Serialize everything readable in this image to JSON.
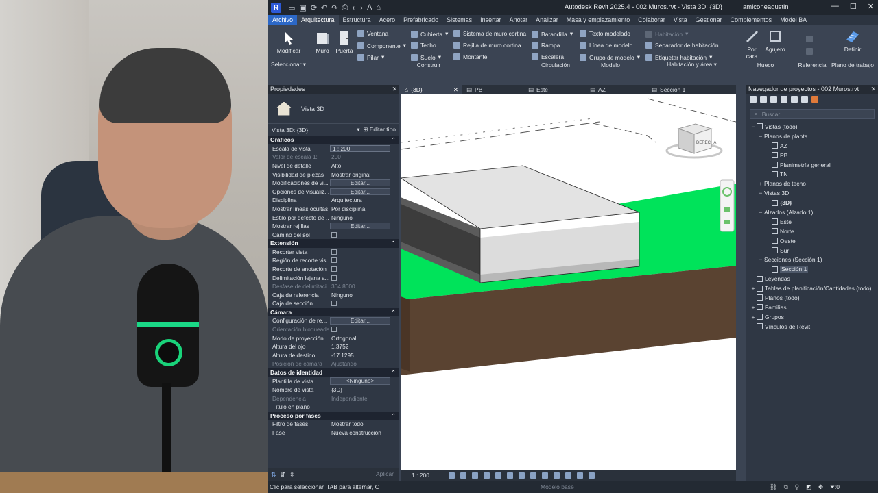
{
  "titlebar": {
    "app_icon": "R",
    "title": "Autodesk Revit 2025.4 - 002 Muros.rvt - Vista 3D: {3D}",
    "user": "amiconeagustin",
    "minimize": "—",
    "maximize": "☐",
    "close": "✕"
  },
  "menu": {
    "file": "Archivo",
    "tabs": [
      "Arquitectura",
      "Estructura",
      "Acero",
      "Prefabricado",
      "Sistemas",
      "Insertar",
      "Anotar",
      "Analizar",
      "Masa y emplazamiento",
      "Colaborar",
      "Vista",
      "Gestionar",
      "Complementos",
      "Model BA"
    ],
    "active": "Arquitectura"
  },
  "ribbon": {
    "modify": "Modificar",
    "select_label": "Seleccionar",
    "build": {
      "muro": "Muro",
      "puerta": "Puerta",
      "ventana": "Ventana",
      "componente": "Componente",
      "pilar": "Pilar",
      "cubierta": "Cubierta",
      "techo": "Techo",
      "suelo": "Suelo",
      "sistema_muro_cortina": "Sistema de muro cortina",
      "rejilla_muro_cortina": "Rejilla de muro cortina",
      "montante": "Montante",
      "label": "Construir"
    },
    "circulation": {
      "barandilla": "Barandilla",
      "rampa": "Rampa",
      "escalera": "Escalera",
      "label": "Circulación"
    },
    "model": {
      "texto_modelado": "Texto modelado",
      "linea_modelo": "Línea de modelo",
      "grupo_modelo": "Grupo de modelo",
      "label": "Modelo"
    },
    "room": {
      "habitacion": "Habitación",
      "separador": "Separador de habitación",
      "etiquetar": "Etiquetar habitación",
      "label": "Habitación y área"
    },
    "opening": {
      "por_cara": "Por cara",
      "agujero": "Agujero",
      "label": "Hueco"
    },
    "reference": {
      "label": "Referencia"
    },
    "workplane": {
      "definir": "Definir",
      "label": "Plano de trabajo"
    }
  },
  "properties": {
    "header": "Propiedades",
    "type_name": "Vista 3D",
    "type_selector": "Vista 3D: {3D}",
    "edit_type": "Editar tipo",
    "sections": [
      {
        "name": "Gráficos",
        "rows": [
          {
            "k": "Escala de vista",
            "v": "1 : 200",
            "kind": "input"
          },
          {
            "k": "Valor de escala    1:",
            "v": "200",
            "kind": "dim"
          },
          {
            "k": "Nivel de detalle",
            "v": "Alto",
            "kind": "text"
          },
          {
            "k": "Visibilidad de piezas",
            "v": "Mostrar original",
            "kind": "text"
          },
          {
            "k": "Modificaciones de vi...",
            "v": "Editar...",
            "kind": "button"
          },
          {
            "k": "Opciones de visualiz...",
            "v": "Editar...",
            "kind": "button"
          },
          {
            "k": "Disciplina",
            "v": "Arquitectura",
            "kind": "text"
          },
          {
            "k": "Mostrar líneas ocultas",
            "v": "Por disciplina",
            "kind": "text"
          },
          {
            "k": "Estilo por defecto de ...",
            "v": "Ninguno",
            "kind": "text"
          },
          {
            "k": "Mostrar rejillas",
            "v": "Editar...",
            "kind": "button"
          },
          {
            "k": "Camino del sol",
            "v": "",
            "kind": "check"
          }
        ]
      },
      {
        "name": "Extensión",
        "rows": [
          {
            "k": "Recortar vista",
            "v": "",
            "kind": "check"
          },
          {
            "k": "Región de recorte vis...",
            "v": "",
            "kind": "check"
          },
          {
            "k": "Recorte de anotación",
            "v": "",
            "kind": "check"
          },
          {
            "k": "Delimitación lejana a...",
            "v": "",
            "kind": "check"
          },
          {
            "k": "Desfase de delimitaci...",
            "v": "304.8000",
            "kind": "dim"
          },
          {
            "k": "Caja de referencia",
            "v": "Ninguno",
            "kind": "text"
          },
          {
            "k": "Caja de sección",
            "v": "",
            "kind": "check"
          }
        ]
      },
      {
        "name": "Cámara",
        "rows": [
          {
            "k": "Configuración de re...",
            "v": "Editar...",
            "kind": "button"
          },
          {
            "k": "Orientación bloqueada",
            "v": "",
            "kind": "dimcheck"
          },
          {
            "k": "Modo de proyección",
            "v": "Ortogonal",
            "kind": "text"
          },
          {
            "k": "Altura del ojo",
            "v": "1.3752",
            "kind": "text"
          },
          {
            "k": "Altura de destino",
            "v": "-17.1295",
            "kind": "text"
          },
          {
            "k": "Posición de cámara",
            "v": "Ajustando",
            "kind": "dim"
          }
        ]
      },
      {
        "name": "Datos de identidad",
        "rows": [
          {
            "k": "Plantilla de vista",
            "v": "<Ninguno>",
            "kind": "button"
          },
          {
            "k": "Nombre de vista",
            "v": "{3D}",
            "kind": "text"
          },
          {
            "k": "Dependencia",
            "v": "Independiente",
            "kind": "dim"
          },
          {
            "k": "Título en plano",
            "v": "",
            "kind": "text"
          }
        ]
      },
      {
        "name": "Proceso por fases",
        "rows": [
          {
            "k": "Filtro de fases",
            "v": "Mostrar todo",
            "kind": "text"
          },
          {
            "k": "Fase",
            "v": "Nueva construcción",
            "kind": "text"
          }
        ]
      }
    ],
    "apply": "Aplicar"
  },
  "view_tabs": [
    {
      "label": "{3D}",
      "active": true
    },
    {
      "label": "PB",
      "active": false
    },
    {
      "label": "Este",
      "active": false
    },
    {
      "label": "AZ",
      "active": false
    },
    {
      "label": "Sección 1",
      "active": false
    }
  ],
  "viewcube_label": "DERECHA",
  "view_control": {
    "scale": "1 : 200"
  },
  "browser": {
    "header": "Navegador de proyectos - 002 Muros.rvt",
    "search_placeholder": "Buscar",
    "tree": [
      {
        "d": 0,
        "t": "−",
        "label": "Vistas (todo)",
        "icon": true
      },
      {
        "d": 1,
        "t": "−",
        "label": "Planos de planta"
      },
      {
        "d": 2,
        "t": "",
        "label": "AZ",
        "icon": true
      },
      {
        "d": 2,
        "t": "",
        "label": "PB",
        "icon": true
      },
      {
        "d": 2,
        "t": "",
        "label": "Planimetría general",
        "icon": true
      },
      {
        "d": 2,
        "t": "",
        "label": "TN",
        "icon": true
      },
      {
        "d": 1,
        "t": "+",
        "label": "Planos de techo"
      },
      {
        "d": 1,
        "t": "−",
        "label": "Vistas 3D"
      },
      {
        "d": 2,
        "t": "",
        "label": "{3D}",
        "icon": true,
        "bold": true
      },
      {
        "d": 1,
        "t": "−",
        "label": "Alzados (Alzado 1)"
      },
      {
        "d": 2,
        "t": "",
        "label": "Este",
        "icon": true
      },
      {
        "d": 2,
        "t": "",
        "label": "Norte",
        "icon": true
      },
      {
        "d": 2,
        "t": "",
        "label": "Oeste",
        "icon": true
      },
      {
        "d": 2,
        "t": "",
        "label": "Sur",
        "icon": true
      },
      {
        "d": 1,
        "t": "−",
        "label": "Secciones (Sección 1)"
      },
      {
        "d": 2,
        "t": "",
        "label": "Sección 1",
        "icon": true,
        "sel": true
      },
      {
        "d": 0,
        "t": "",
        "label": "Leyendas",
        "icon": true
      },
      {
        "d": 0,
        "t": "+",
        "label": "Tablas de planificación/Cantidades (todo)",
        "icon": true
      },
      {
        "d": 0,
        "t": "",
        "label": "Planos (todo)",
        "icon": true
      },
      {
        "d": 0,
        "t": "+",
        "label": "Familias",
        "icon": true
      },
      {
        "d": 0,
        "t": "+",
        "label": "Grupos",
        "icon": true
      },
      {
        "d": 0,
        "t": "",
        "label": "Vínculos de Revit",
        "icon": true
      }
    ]
  },
  "status": {
    "hint": "Clic para seleccionar, TAB para alternar, C",
    "model": "Modelo base",
    "filter_count": ":0"
  },
  "colors": {
    "accent": "#2c68c7",
    "ground_green": "#00e35a",
    "earth_brown": "#5a4331"
  }
}
